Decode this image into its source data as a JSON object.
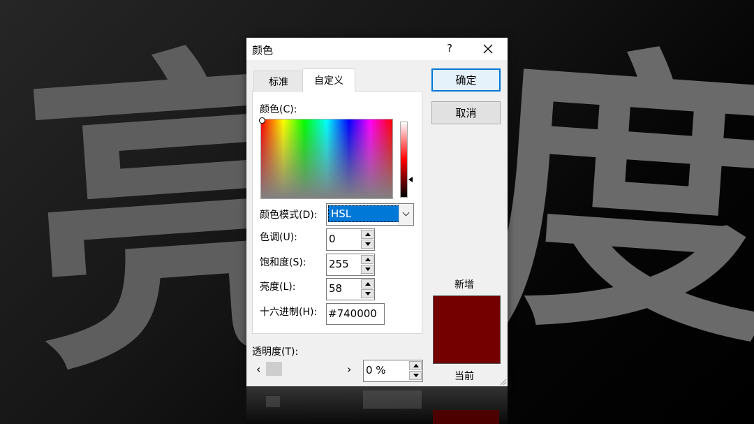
{
  "background": {
    "char_left": "亮",
    "char_right": "度"
  },
  "dialog": {
    "title": "颜色",
    "help": "?",
    "tabs": [
      {
        "label": "标准"
      },
      {
        "label": "自定义"
      }
    ],
    "colors_label": "颜色(C):",
    "mode_label": "颜色模式(D):",
    "mode_value": "HSL",
    "hue_label": "色调(U):",
    "hue_value": "0",
    "sat_label": "饱和度(S):",
    "sat_value": "255",
    "lum_label": "亮度(L):",
    "lum_value": "58",
    "hex_label": "十六进制(H):",
    "hex_value": "#740000",
    "transparency_label": "透明度(T):",
    "transparency_value": "0 %",
    "ok_label": "确定",
    "cancel_label": "取消",
    "new_label": "新增",
    "current_label": "当前",
    "new_color": "#740000",
    "current_color": "#740000"
  }
}
